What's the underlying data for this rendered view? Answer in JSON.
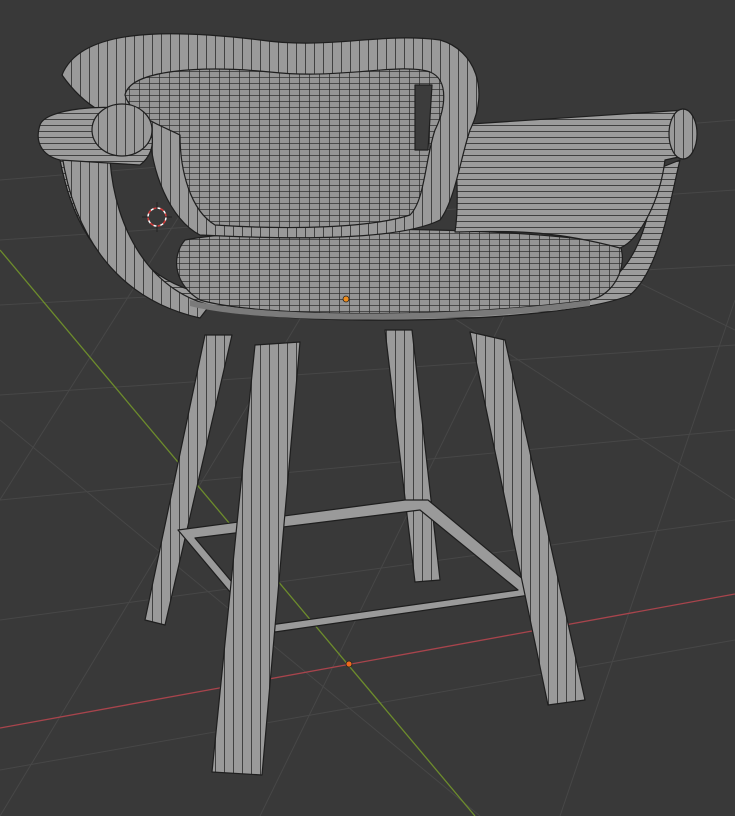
{
  "viewport": {
    "background": "#393939",
    "grid_color": "#474747",
    "x_axis_color": "#a8444c",
    "y_axis_color": "#6d8c2c"
  },
  "model": {
    "surface_color": "#9a9a9a",
    "surface_shade": "#7a7a7a",
    "wire_color": "#222222",
    "origin_color": "#ee8c1c"
  },
  "icons": {
    "origin": "origin-point-icon",
    "cursor": "3d-cursor-icon"
  }
}
